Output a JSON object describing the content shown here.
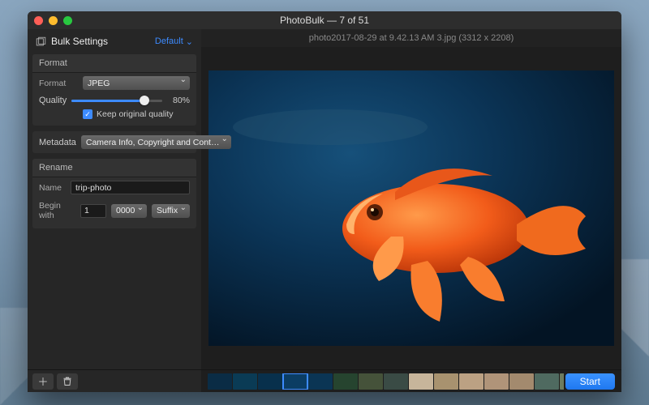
{
  "window": {
    "title": "PhotoBulk — 7 of 51"
  },
  "sidebar": {
    "header_label": "Bulk Settings",
    "preset_label": "Default",
    "format": {
      "section_label": "Format",
      "format_label": "Format",
      "format_value": "JPEG",
      "quality_label": "Quality",
      "quality_percent": "80%",
      "keep_original_label": "Keep original quality",
      "keep_original_checked": true
    },
    "metadata": {
      "label": "Metadata",
      "value": "Camera Info, Copyright and Cont…"
    },
    "rename": {
      "section_label": "Rename",
      "name_label": "Name",
      "name_value": "trip-photo",
      "begin_label": "Begin with",
      "begin_value": "1",
      "pad_value": "0000",
      "position_value": "Suffix"
    }
  },
  "preview": {
    "filename_line": "photo2017-08-29 at 9.42.13 AM 3.jpg (3312 x 2208)"
  },
  "footer": {
    "start_label": "Start"
  },
  "thumb_colors": [
    "#0a2c45",
    "#0a3b55",
    "#08304c",
    "#0b3d63",
    "#0b3554",
    "#26442f",
    "#45523a",
    "#3a4b45",
    "#c7b59b",
    "#a8926f",
    "#bca183",
    "#b09479",
    "#a38a6e",
    "#4f6a60",
    "#6e7c5f",
    "#5d6e58"
  ],
  "selected_thumb_index": 3
}
